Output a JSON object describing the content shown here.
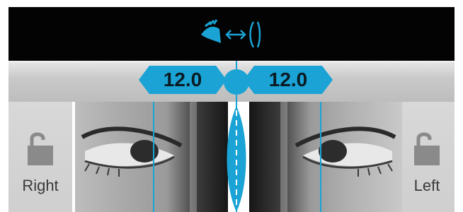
{
  "header": {
    "icon": "eye-vertex-distance-icon"
  },
  "values": {
    "right": "12.0",
    "left": "12.0"
  },
  "panels": {
    "right": {
      "label": "Right",
      "icon": "unlock-icon"
    },
    "left": {
      "label": "Left",
      "icon": "unlock-icon"
    }
  },
  "colors": {
    "accent": "#1aa3d4",
    "bar": "#030303",
    "panel": "#d4d4d4"
  }
}
